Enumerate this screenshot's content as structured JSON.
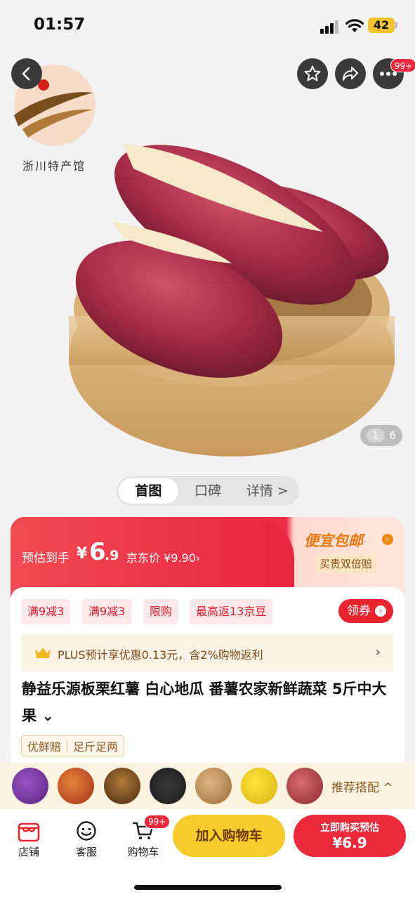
{
  "status": {
    "time": "01:57",
    "battery": "42"
  },
  "gallery": {
    "logo_text": "浙川特产馆",
    "more_badge": "99+",
    "pager": {
      "current": "1",
      "total": "6"
    }
  },
  "tabs": [
    {
      "label": "首图",
      "active": true
    },
    {
      "label": "口碑",
      "active": false
    },
    {
      "label": "详情 >",
      "active": false
    }
  ],
  "price": {
    "estimate_label": "预估到手",
    "currency": "¥",
    "integer": "6",
    "decimal": ".9",
    "jd_price": "京东价 ¥9.90›",
    "cheap_label": "便宜包邮",
    "guarantee": "买贵双倍赔"
  },
  "promos": [
    "满9减3",
    "满9减3",
    "限购",
    "最高返13京豆"
  ],
  "coupon_label": "领券",
  "plus_text": "PLUS预计享优惠0.13元，含2%购物返利",
  "product_title": "静益乐源板栗红薯 白心地瓜 番薯农家新鲜蔬菜 5斤中大果",
  "service_tags": [
    "优鲜赔",
    "足斤足两"
  ],
  "recommend_label": "推荐搭配 ^",
  "recommend_thumbs": [
    {
      "name": "purple-sweet-potato",
      "color": "#7a3aa0"
    },
    {
      "name": "fruit-basket",
      "color": "#c8502a"
    },
    {
      "name": "sauce-jars",
      "color": "#7a4a1a"
    },
    {
      "name": "black-sesame",
      "color": "#2a2a2a"
    },
    {
      "name": "grain-powder",
      "color": "#b5834a"
    },
    {
      "name": "lemons",
      "color": "#f2d21a"
    },
    {
      "name": "meat",
      "color": "#a03a40"
    }
  ],
  "bottom": {
    "store": "店铺",
    "service": "客服",
    "cart": "购物车",
    "cart_badge": "99+",
    "add_to_cart": "加入购物车",
    "buy_line1": "立即购买预估",
    "buy_line2": "¥6.9"
  }
}
